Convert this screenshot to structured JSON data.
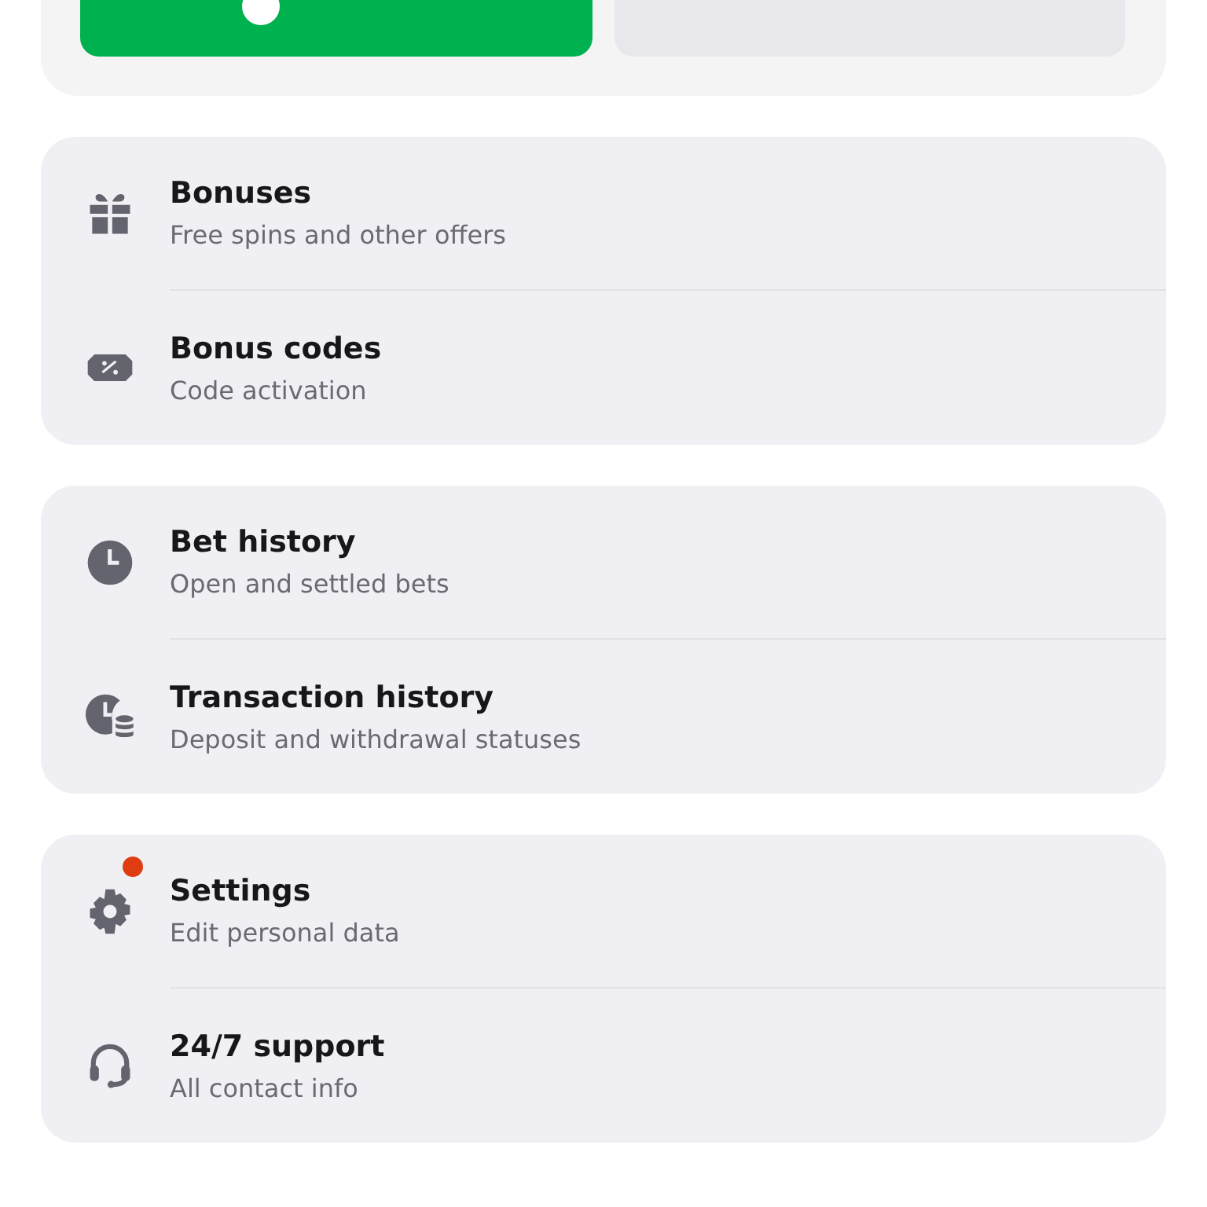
{
  "wallet_actions": [
    {
      "kind": "deposit"
    },
    {
      "kind": "withdraw"
    }
  ],
  "groups": [
    {
      "items": [
        {
          "kind": "gift",
          "title": "Bonuses",
          "subtitle": "Free spins and other offers",
          "badge": false
        },
        {
          "kind": "coupon",
          "title": "Bonus codes",
          "subtitle": "Code activation",
          "badge": false
        }
      ]
    },
    {
      "items": [
        {
          "kind": "clock",
          "title": "Bet history",
          "subtitle": "Open and settled bets",
          "badge": false
        },
        {
          "kind": "clock-coins",
          "title": "Transaction history",
          "subtitle": "Deposit and withdrawal statuses",
          "badge": false
        }
      ]
    },
    {
      "items": [
        {
          "kind": "gear",
          "title": "Settings",
          "subtitle": "Edit personal data",
          "badge": true
        },
        {
          "kind": "headset",
          "title": "24/7 support",
          "subtitle": "All contact info",
          "badge": false
        }
      ]
    }
  ]
}
